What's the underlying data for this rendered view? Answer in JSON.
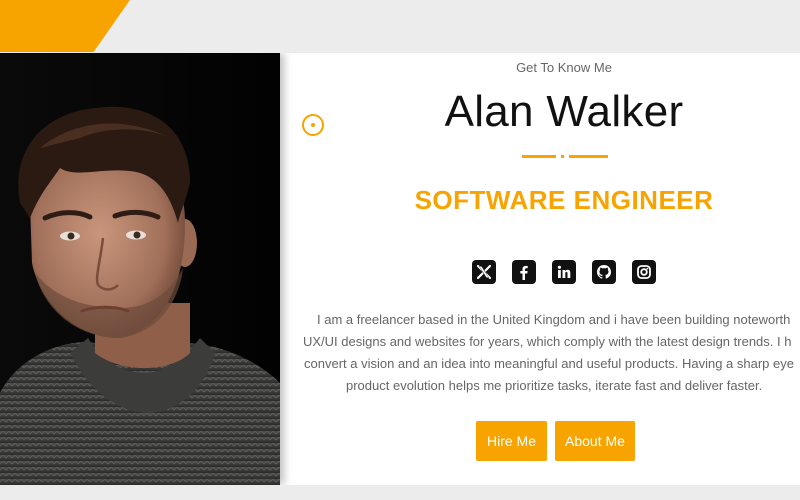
{
  "profile": {
    "eyebrow": "Get To Know Me",
    "name": "Alan Walker",
    "role": "SOFTWARE ENGINEER",
    "bio_lines": [
      "I am a freelancer based in the United Kingdom and i have been building noteworth",
      "UX/UI designs and websites for years, which comply with the latest design trends. I h",
      "convert a vision and an idea into meaningful and useful products. Having a sharp eye",
      "product evolution helps me prioritize tasks, iterate fast and deliver faster."
    ]
  },
  "socials": [
    "x-icon",
    "facebook-icon",
    "linkedin-icon",
    "github-icon",
    "instagram-icon"
  ],
  "buttons": {
    "hire": "Hire Me",
    "about": "About Me"
  },
  "colors": {
    "accent": "#f7a400",
    "text_dark": "#111111",
    "text_muted": "#666666",
    "page_bg": "#ececec"
  }
}
